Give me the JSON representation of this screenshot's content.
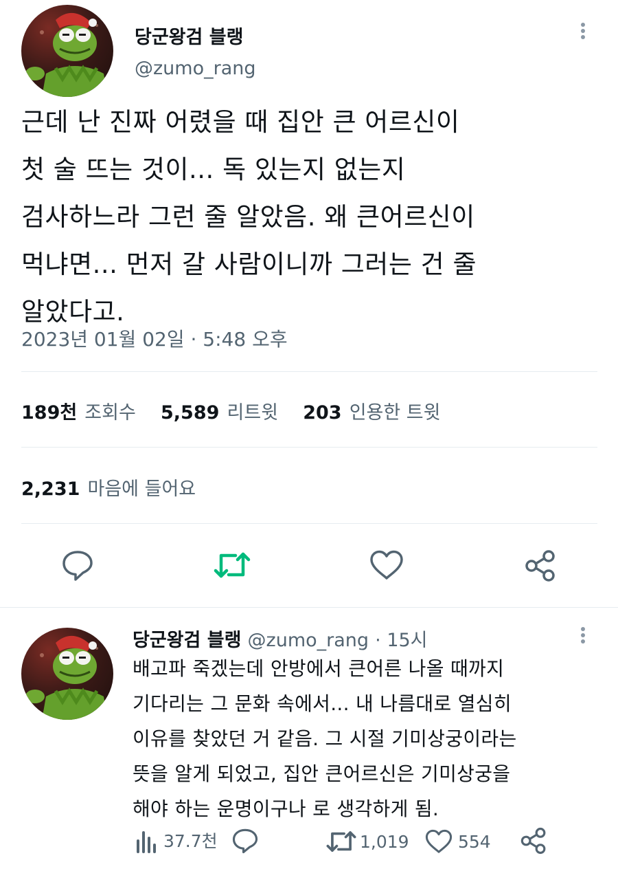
{
  "tweet": {
    "author_name": "당군왕검 블랭",
    "author_handle": "@zumo_rang",
    "text": "근데 난 진짜 어렸을 때 집안 큰 어르신이\n첫 술 뜨는 것이... 독 있는지 없는지\n검사하느라 그런 줄 알았음. 왜 큰어르신이\n먹냐면... 먼저 갈 사람이니까 그러는 건 줄\n알았다고.",
    "timestamp": "2023년 01월 02일 · 5:48 오후",
    "stats": {
      "views_num": "189천",
      "views_label": "조회수",
      "retweets_num": "5,589",
      "retweets_label": "리트윗",
      "quotes_num": "203",
      "quotes_label": "인용한 트윗",
      "likes_num": "2,231",
      "likes_label": "마음에 들어요"
    },
    "retweet_color": "#00ba7c"
  },
  "reply": {
    "author_name": "당군왕검 블랭",
    "author_handle": "@zumo_rang",
    "time": "· 15시",
    "text": "배고파 죽겠는데 안방에서 큰어른 나올 때까지\n기다리는 그 문화 속에서... 내 나름대로 열심히\n이유를 찾았던 거 같음. 그 시절 기미상궁이라는\n뜻을 알게 되었고, 집안 큰어르신은 기미상궁을\n해야 하는 운명이구나 로 생각하게 됨.",
    "views": "37.7천",
    "retweets": "1,019",
    "likes": "554"
  }
}
